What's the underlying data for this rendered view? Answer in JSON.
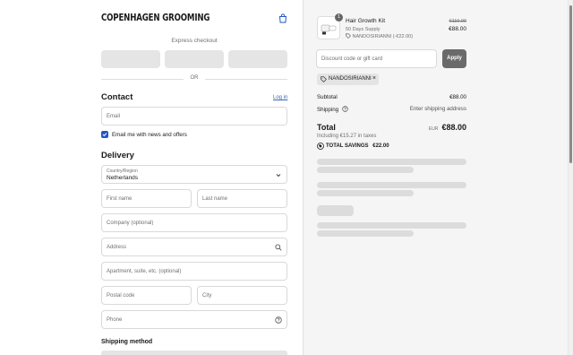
{
  "brand": {
    "logo": "COPENHAGEN GROOMING"
  },
  "express": {
    "title": "Express checkout",
    "or": "OR"
  },
  "contact": {
    "title": "Contact",
    "login": "Log in",
    "email_placeholder": "Email",
    "newsletter": "Email me with news and offers",
    "newsletter_checked": true
  },
  "delivery": {
    "title": "Delivery",
    "country_label": "Country/Region",
    "country_value": "Netherlands",
    "first_name": "First name",
    "last_name": "Last name",
    "company": "Company (optional)",
    "address": "Address",
    "apartment": "Apartment, suite, etc. (optional)",
    "postal": "Postal code",
    "city": "City",
    "phone": "Phone"
  },
  "shipping_method": {
    "title": "Shipping method"
  },
  "summary": {
    "item": {
      "name": "Hair Growth Kit",
      "variant": "50 Days Supply",
      "discount": "NANDOSIRIANNI (-€22.00)",
      "old_price": "€110.00",
      "price": "€88.00",
      "quantity": "1"
    },
    "discount_placeholder": "Discount code or gift card",
    "apply": "Apply",
    "applied_code": "NANDOSIRIANNI",
    "subtotal_label": "Subtotal",
    "subtotal_value": "€88.00",
    "shipping_label": "Shipping",
    "shipping_value": "Enter shipping address",
    "total_label": "Total",
    "currency": "EUR",
    "total_value": "€88.00",
    "taxes": "Including €15.27 in taxes",
    "savings_label": "TOTAL SAVINGS",
    "savings_value": "€22.00"
  },
  "colors": {
    "accent": "#2456c5",
    "link": "#3b66b0",
    "panel": "#f5f5f5"
  }
}
